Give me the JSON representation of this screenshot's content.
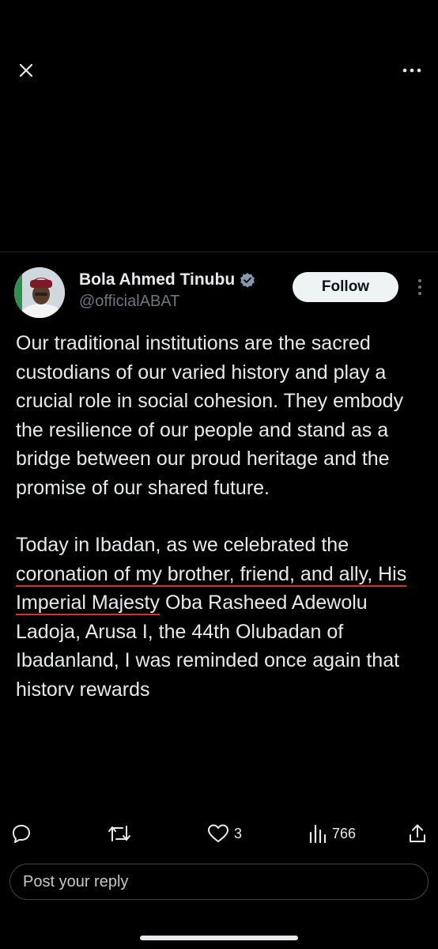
{
  "tweet": {
    "author_name": "Bola Ahmed Tinubu",
    "author_handle": "@officialABAT",
    "follow_label": "Follow",
    "paragraph1": "Our traditional institutions are the sacred custodians of our varied history and play a crucial role in social cohesion. They embody the resilience of our people and stand as a bridge between our proud heritage and the promise of our shared future.",
    "paragraph2_before": "Today in Ibadan, as we celebrated the ",
    "paragraph2_underlined": "coronation of my brother, friend, and ally, His Imperial Majesty",
    "paragraph2_after": "  Oba Rasheed Adewolu Ladoja, Arusa I, the 44th Olubadan of Ibadanland, I was reminded once again that history rewards"
  },
  "actions": {
    "likes_count": "3",
    "views_count": "766"
  },
  "reply": {
    "placeholder": "Post your reply"
  },
  "icons": {
    "close": "close-icon",
    "more": "more-horizontal-icon",
    "verified": "verified-badge-icon",
    "reply": "reply-icon",
    "repost": "repost-icon",
    "like": "heart-icon",
    "views": "views-chart-icon",
    "share": "share-icon"
  },
  "colors": {
    "background": "#000000",
    "text": "#e7e9ea",
    "secondary": "#71767b",
    "underline": "#d9302b"
  }
}
